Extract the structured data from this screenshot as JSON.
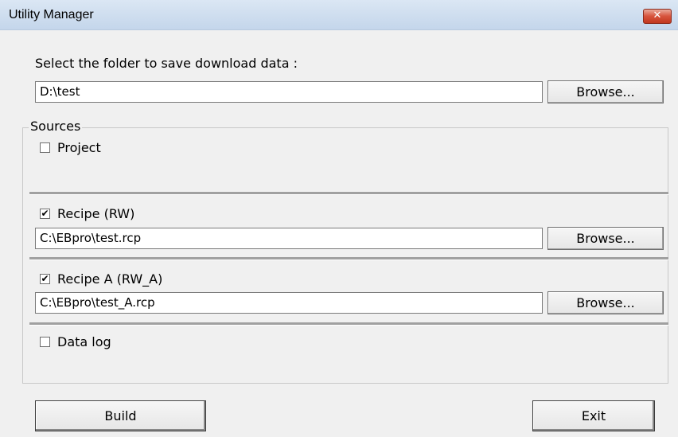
{
  "window": {
    "title": "Utility Manager",
    "close_symbol": "✕"
  },
  "folder": {
    "prompt": "Select the folder to save download data :",
    "path": "D:\\test",
    "browse_label": "Browse..."
  },
  "sources": {
    "group_label": "Sources",
    "project": {
      "label": "Project",
      "checked": false,
      "check_mark": ""
    },
    "recipe": {
      "label": "Recipe (RW)",
      "checked": true,
      "check_mark": "✔",
      "path": "C:\\EBpro\\test.rcp",
      "browse_label": "Browse..."
    },
    "recipe_a": {
      "label": "Recipe A (RW_A)",
      "checked": true,
      "check_mark": "✔",
      "path": "C:\\EBpro\\test_A.rcp",
      "browse_label": "Browse..."
    },
    "data_log": {
      "label": "Data log",
      "checked": false,
      "check_mark": ""
    }
  },
  "actions": {
    "build_label": "Build",
    "exit_label": "Exit"
  }
}
